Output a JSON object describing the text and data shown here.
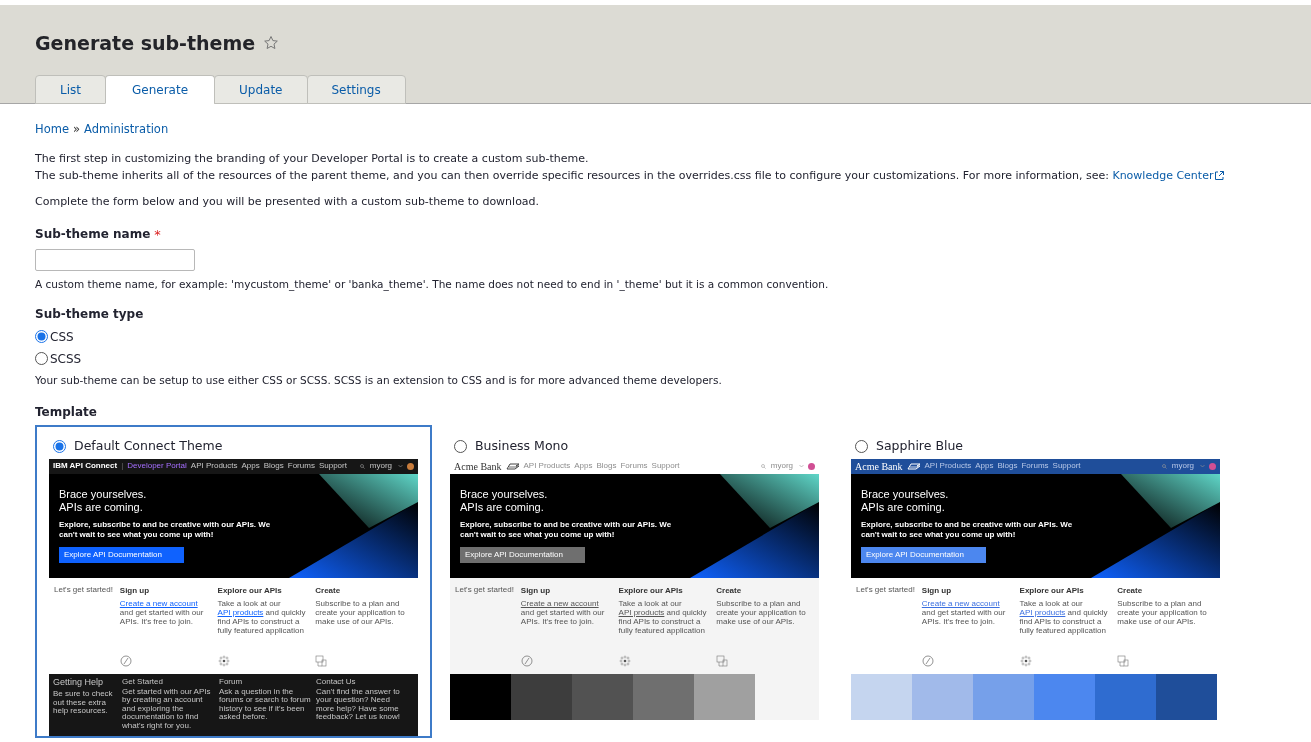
{
  "page": {
    "title": "Generate sub-theme"
  },
  "tabs": [
    {
      "label": "List",
      "selected": false
    },
    {
      "label": "Generate",
      "selected": true
    },
    {
      "label": "Update",
      "selected": false
    },
    {
      "label": "Settings",
      "selected": false
    }
  ],
  "breadcrumb": {
    "items": [
      "Home",
      "Administration"
    ],
    "separator": "»"
  },
  "intro": {
    "line_1": "The first step in customizing the branding of your Developer Portal is to create a custom sub-theme.",
    "line_2": "The sub-theme inherits all of the resources of the parent theme, and you can then override specific resources in the overrides.css file to configure your customizations. For more information, see:",
    "link": "Knowledge Center"
  },
  "instructions": "Complete the form below and you will be presented with a custom sub-theme to download.",
  "name_field": {
    "label": "Sub-theme name",
    "required": true,
    "required_mark": "*",
    "help": "A custom theme name, for example: 'mycustom_theme' or 'banka_theme'. The name does not need to end in '_theme' but it is a common convention."
  },
  "type_field": {
    "label": "Sub-theme type",
    "options": [
      {
        "label": "CSS",
        "selected": true
      },
      {
        "label": "SCSS",
        "selected": false
      }
    ],
    "help": "Your sub-theme can be setup to use either CSS or SCSS. SCSS is an extension to CSS and is for more advanced theme developers."
  },
  "template_field": {
    "label": "Template",
    "options": [
      {
        "name": "Default Connect Theme",
        "selected": true,
        "kind": "ibm",
        "preview": {
          "nav": {
            "brand": "IBM API Connect",
            "separator": "|",
            "portal": "Developer Portal",
            "items": [
              "API Products",
              "Apps",
              "Blogs",
              "Forums",
              "Support"
            ],
            "user": "myorg"
          },
          "hero": {
            "heading": "Brace yourselves. APIs are coming.",
            "text": "Explore, subscribe to and be creative with our APIs. We can't wait to see what you come up with!",
            "button": "Explore API Documentation"
          },
          "features": {
            "intro": "Let's get started!",
            "columns": [
              {
                "title": "Sign up",
                "body": [
                  {
                    "text": "Create a new account",
                    "link": true
                  },
                  {
                    "text": " and get started with our APIs. It's free to join.",
                    "link": false
                  }
                ]
              },
              {
                "title": "Explore our APIs",
                "body": [
                  {
                    "text": "Take a look at our ",
                    "link": false
                  },
                  {
                    "text": "API products",
                    "link": true
                  },
                  {
                    "text": " and quickly find APIs to construct a fully featured application",
                    "link": false
                  }
                ]
              },
              {
                "title": "Create",
                "body": [
                  {
                    "text": "Subscribe to a plan and create your application to make use of our APIs.",
                    "link": false
                  }
                ]
              }
            ]
          },
          "footer": {
            "title": "Getting Help",
            "text": "Be sure to check out these extra help resources.",
            "columns": [
              {
                "title": "Get Started",
                "body": "Get started with our APIs by creating an account and exploring the documentation to find what's right for you."
              },
              {
                "title": "Forum",
                "body": "Ask a question in the forums or search to forum history to see if it's been asked before."
              },
              {
                "title": "Contact Us",
                "body": "Can't find the answer to your question? Need more help? Have some feedback? Let us know!"
              }
            ]
          }
        }
      },
      {
        "name": "Business Mono",
        "selected": false,
        "kind": "mono",
        "preview": {
          "nav": {
            "brand": "Acme Bank",
            "items": [
              "API Products",
              "Apps",
              "Blogs",
              "Forums",
              "Support"
            ],
            "user": "myorg"
          },
          "hero": {
            "heading": "Brace yourselves. APIs are coming.",
            "text": "Explore, subscribe to and be creative with our APIs. We can't wait to see what you come up with!",
            "button": "Explore API Documentation"
          },
          "features": {
            "intro": "Let's get started!",
            "columns": [
              {
                "title": "Sign up",
                "body": [
                  {
                    "text": "Create a new account",
                    "link": true
                  },
                  {
                    "text": " and get started with our APIs. It's free to join.",
                    "link": false
                  }
                ]
              },
              {
                "title": "Explore our APIs",
                "body": [
                  {
                    "text": "Take a look at our ",
                    "link": false
                  },
                  {
                    "text": "API products",
                    "link": true
                  },
                  {
                    "text": " and quickly find APIs to construct a fully featured application",
                    "link": false
                  }
                ]
              },
              {
                "title": "Create",
                "body": [
                  {
                    "text": "Subscribe to a plan and create your application to make use of our APIs.",
                    "link": false
                  }
                ]
              }
            ]
          },
          "palette": [
            {
              "color": "#000000"
            },
            {
              "color": "#3d3d3d"
            },
            {
              "color": "#525252"
            },
            {
              "color": "#6f6f6f"
            },
            {
              "color": "#a0a0a0"
            }
          ]
        }
      },
      {
        "name": "Sapphire Blue",
        "selected": false,
        "kind": "blue",
        "preview": {
          "nav": {
            "brand": "Acme Bank",
            "items": [
              "API Products",
              "Apps",
              "Blogs",
              "Forums",
              "Support"
            ],
            "user": "myorg"
          },
          "hero": {
            "heading": "Brace yourselves. APIs are coming.",
            "text": "Explore, subscribe to and be creative with our APIs. We can't wait to see what you come up with!",
            "button": "Explore API Documentation"
          },
          "features": {
            "intro": "Let's get started!",
            "columns": [
              {
                "title": "Sign up",
                "body": [
                  {
                    "text": "Create a new account",
                    "link": true
                  },
                  {
                    "text": " and get started with our APIs. It's free to join.",
                    "link": false
                  }
                ]
              },
              {
                "title": "Explore our APIs",
                "body": [
                  {
                    "text": "Take a look at our ",
                    "link": false
                  },
                  {
                    "text": "API products",
                    "link": true
                  },
                  {
                    "text": " and quickly find APIs to construct a fully featured application",
                    "link": false
                  }
                ]
              },
              {
                "title": "Create",
                "body": [
                  {
                    "text": "Subscribe to a plan and create your application to make use of our APIs.",
                    "link": false
                  }
                ]
              }
            ]
          },
          "palette": [
            {
              "color": "#c5d5ef"
            },
            {
              "color": "#a1baea"
            },
            {
              "color": "#76a0ea"
            },
            {
              "color": "#4c87ef"
            },
            {
              "color": "#2f6cd0"
            },
            {
              "color": "#1f4e9a"
            }
          ]
        }
      }
    ]
  }
}
